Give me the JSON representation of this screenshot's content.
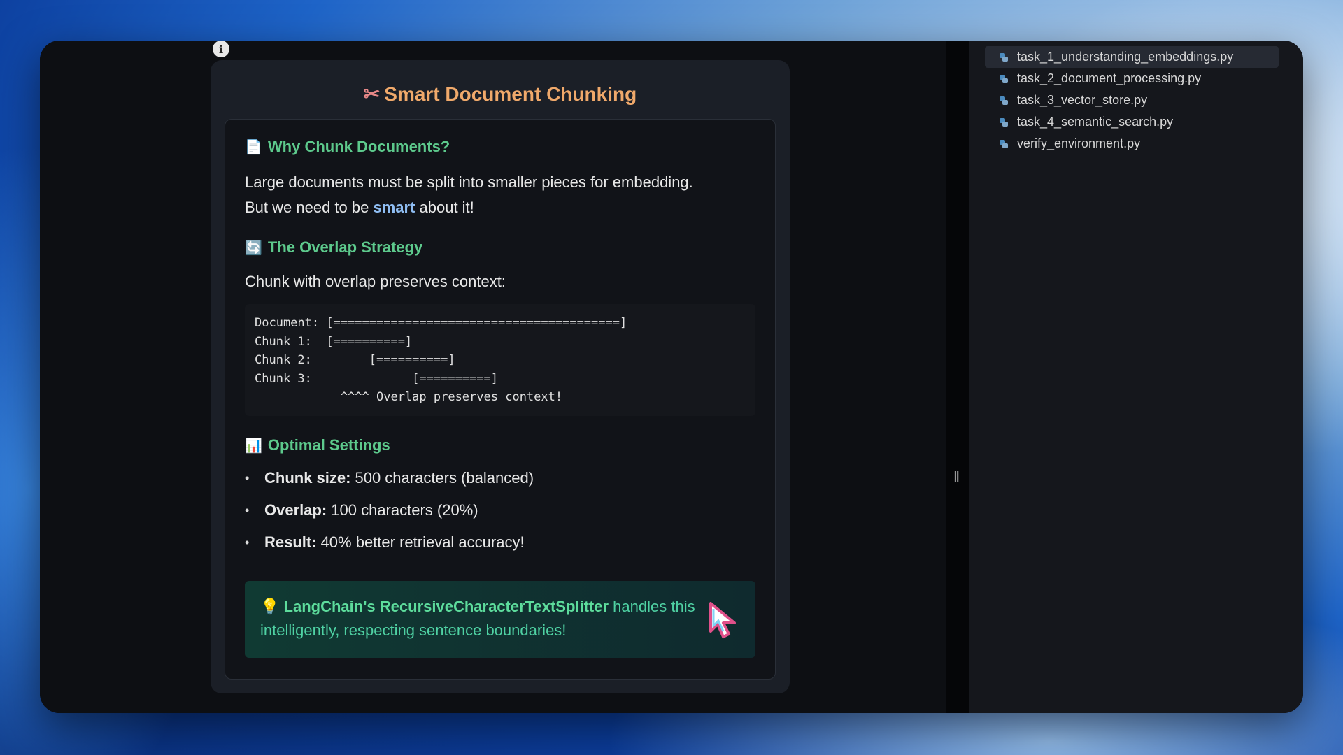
{
  "preview": {
    "info_label": "i",
    "title": "Smart Document Chunking",
    "sections": {
      "why": {
        "heading": "Why Chunk Documents?",
        "text_line1": "Large documents must be split into smaller pieces for embedding.",
        "text_pre": "But we need to be ",
        "text_highlight": "smart",
        "text_post": " about it!"
      },
      "overlap": {
        "heading": "The Overlap Strategy",
        "text": "Chunk with overlap preserves context:",
        "code": "Document: [========================================]\nChunk 1:  [==========]\nChunk 2:        [==========]\nChunk 3:              [==========]\n            ^^^^ Overlap preserves context!"
      },
      "settings": {
        "heading": "Optimal Settings",
        "items": [
          {
            "label": "Chunk size:",
            "value": "500 characters (balanced)"
          },
          {
            "label": "Overlap:",
            "value": "100 characters (20%)"
          },
          {
            "label": "Result:",
            "value": "40% better retrieval accuracy!"
          }
        ]
      },
      "tip": {
        "strong": "LangChain's RecursiveCharacterTextSplitter",
        "rest": " handles this intelligently, respecting sentence boundaries!"
      }
    }
  },
  "splitter": {
    "grip": "‖"
  },
  "files": [
    {
      "name": "task_1_understanding_embeddings.py",
      "active": true
    },
    {
      "name": "task_2_document_processing.py",
      "active": false
    },
    {
      "name": "task_3_vector_store.py",
      "active": false
    },
    {
      "name": "task_4_semantic_search.py",
      "active": false
    },
    {
      "name": "verify_environment.py",
      "active": false
    }
  ]
}
